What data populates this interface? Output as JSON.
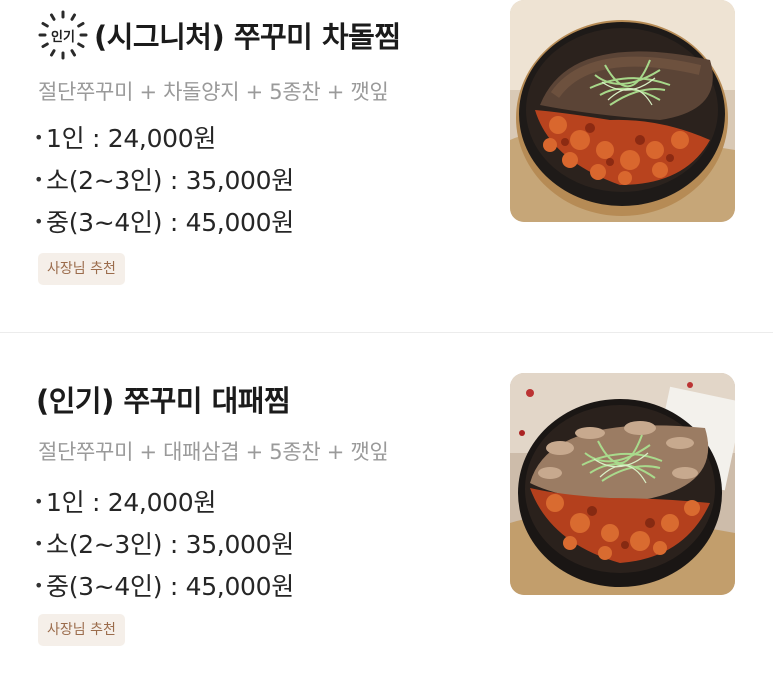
{
  "menu_items": [
    {
      "badge_label": "인기",
      "title": "(시그니처) 쭈꾸미 차돌찜",
      "description": "절단쭈꾸미 + 차돌양지 + 5종찬 + 깻잎",
      "prices": [
        "1인 : 24,000원",
        "소(2~3인) : 35,000원",
        "중(3~4인) : 45,000원"
      ],
      "tag": "사장님 추천",
      "image_icon": "spicy-webfoot-octopus-brisket-stew-photo"
    },
    {
      "title": "(인기) 쭈꾸미 대패찜",
      "description": "절단쭈꾸미 + 대패삼겹 + 5종찬 + 깻잎",
      "prices": [
        "1인 : 24,000원",
        "소(2~3인) : 35,000원",
        "중(3~4인) : 45,000원"
      ],
      "tag": "사장님 추천",
      "image_icon": "spicy-webfoot-octopus-pork-belly-stew-photo"
    }
  ],
  "colors": {
    "title": "#1b1b1b",
    "description": "#9a9a9a",
    "tag_background": "#f5efe9",
    "tag_text": "#9b6c4c",
    "divider": "#ececec"
  }
}
